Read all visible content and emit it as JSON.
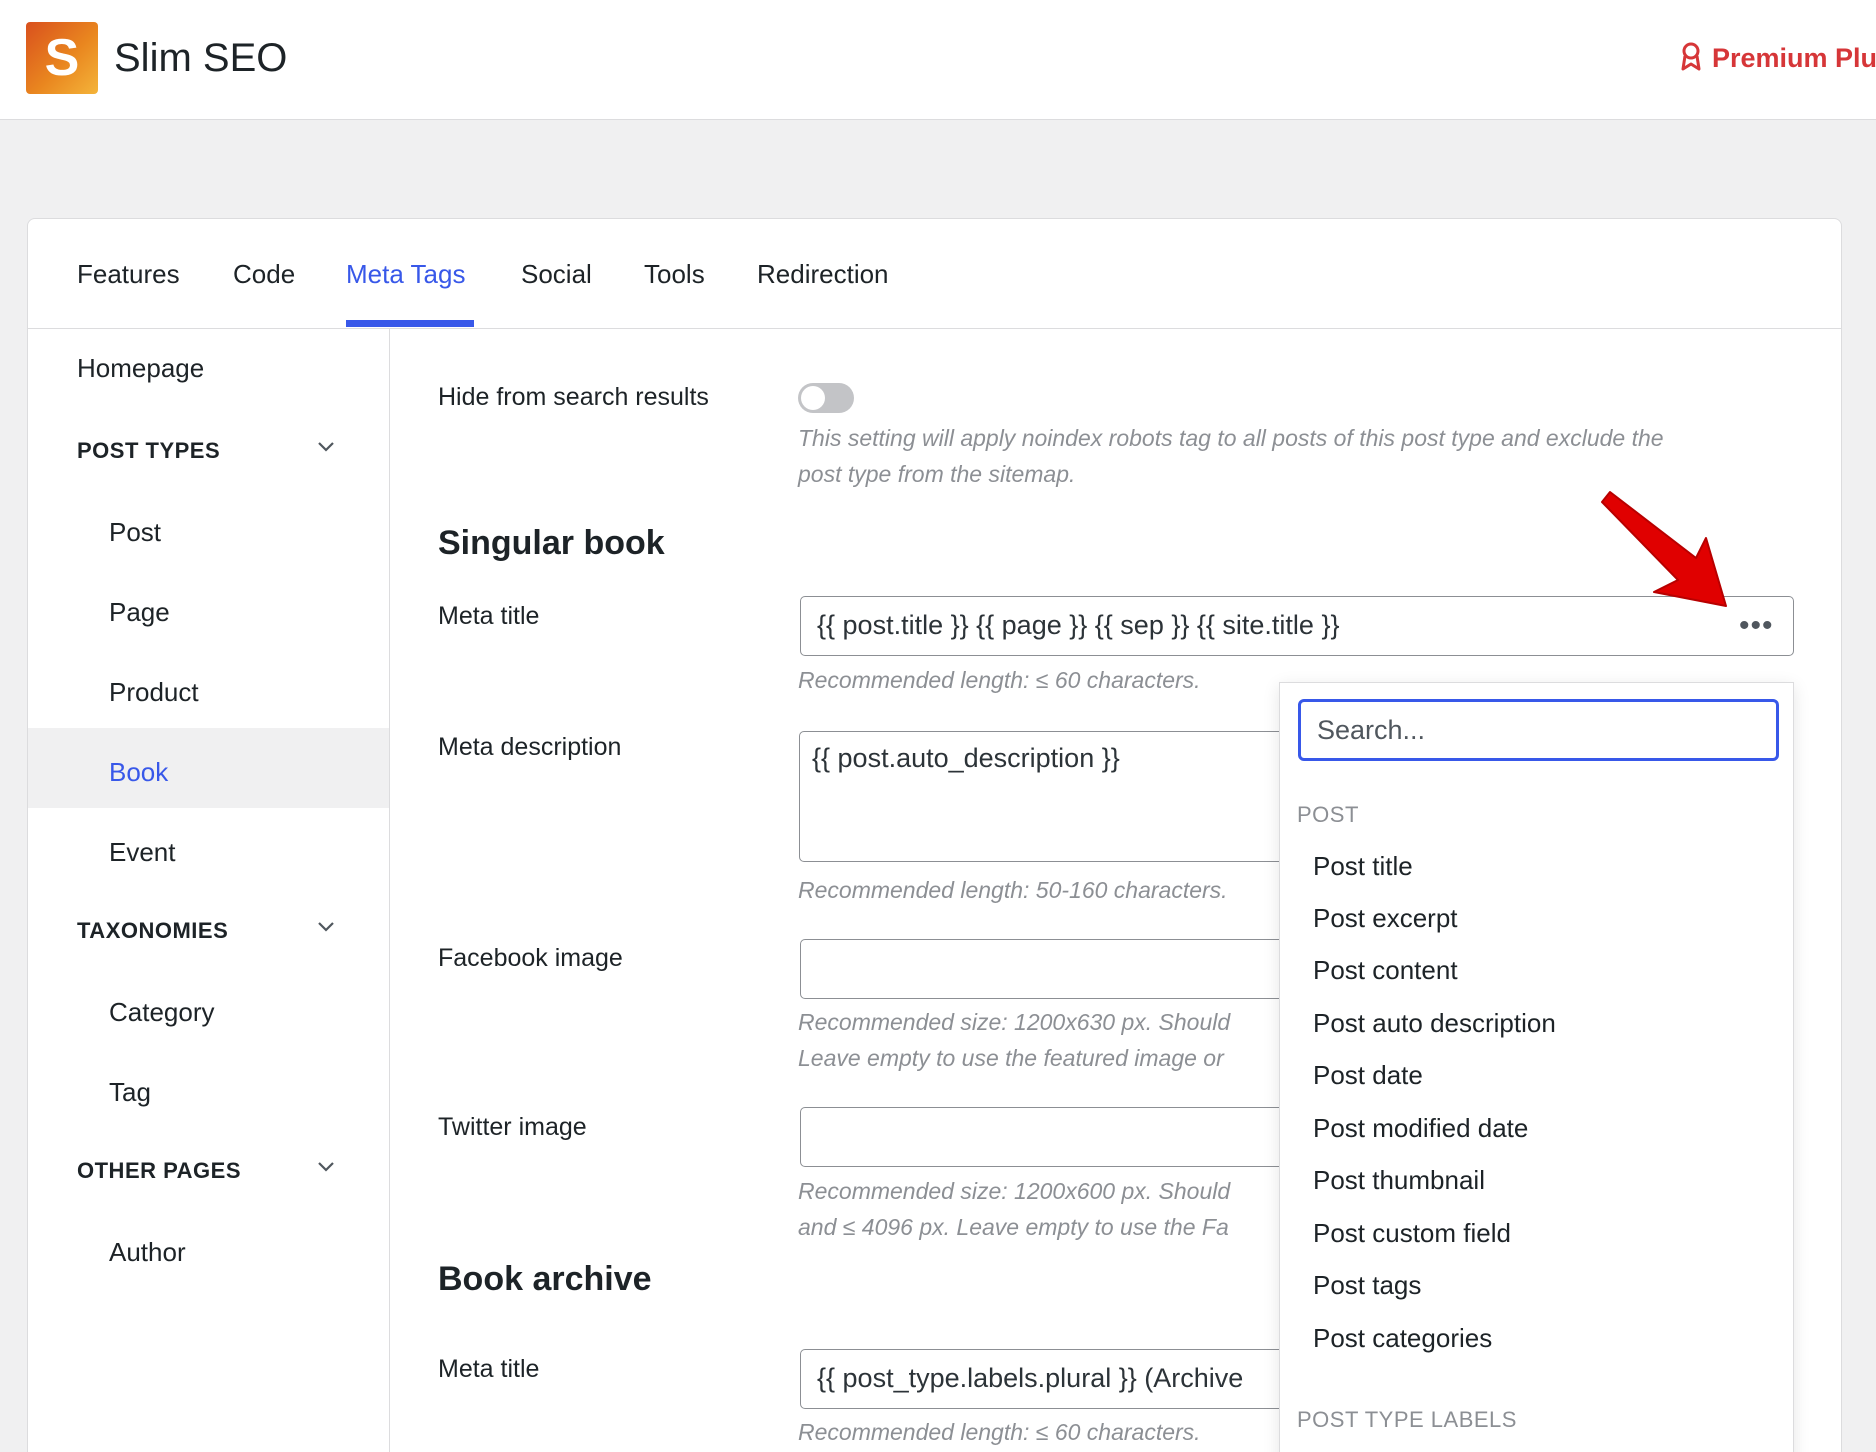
{
  "header": {
    "logo_letter": "S",
    "app_title": "Slim SEO",
    "premium_label": "Premium Plu"
  },
  "tabs": [
    {
      "label": "Features"
    },
    {
      "label": "Code"
    },
    {
      "label": "Meta Tags"
    },
    {
      "label": "Social"
    },
    {
      "label": "Tools"
    },
    {
      "label": "Redirection"
    }
  ],
  "sidebar": {
    "homepage": "Homepage",
    "post_types_heading": "POST TYPES",
    "post_types": [
      "Post",
      "Page",
      "Product",
      "Book",
      "Event"
    ],
    "taxonomies_heading": "TAXONOMIES",
    "taxonomies": [
      "Category",
      "Tag"
    ],
    "other_pages_heading": "OTHER PAGES",
    "other_pages": [
      "Author"
    ],
    "active_item": "Book"
  },
  "main": {
    "hide_label": "Hide from search results",
    "hide_enabled": false,
    "hide_hint_1": "This setting will apply noindex robots tag to all posts of this post type and exclude the",
    "hide_hint_2": "post type from the sitemap.",
    "singular_title": "Singular book",
    "meta_title_label": "Meta title",
    "meta_title_value": "{{ post.title }} {{ page }} {{ sep }} {{ site.title }}",
    "meta_title_hint": "Recommended length: ≤ 60 characters.",
    "meta_desc_label": "Meta description",
    "meta_desc_value": "{{ post.auto_description }}",
    "meta_desc_hint": "Recommended length: 50-160 characters.",
    "fb_label": "Facebook image",
    "fb_hint_1": "Recommended size: 1200x630 px. Should",
    "fb_hint_2": "Leave empty to use the featured image or",
    "tw_label": "Twitter image",
    "tw_hint_1": "Recommended size: 1200x600 px. Should",
    "tw_hint_2": "and ≤ 4096 px. Leave empty to use the Fa",
    "archive_title": "Book archive",
    "archive_meta_title_label": "Meta title",
    "archive_meta_title_value": "{{ post_type.labels.plural }} (Archive",
    "archive_meta_title_hint": "Recommended length: ≤ 60 characters.",
    "more_icon": "•••"
  },
  "dropdown": {
    "search_placeholder": "Search...",
    "group_post": "POST",
    "items": [
      "Post title",
      "Post excerpt",
      "Post content",
      "Post auto description",
      "Post date",
      "Post modified date",
      "Post thumbnail",
      "Post custom field",
      "Post tags",
      "Post categories"
    ],
    "group_post_type_labels": "POST TYPE LABELS"
  },
  "colors": {
    "accent": "#3858e9",
    "premium": "#d63638",
    "arrow": "#e00000"
  }
}
